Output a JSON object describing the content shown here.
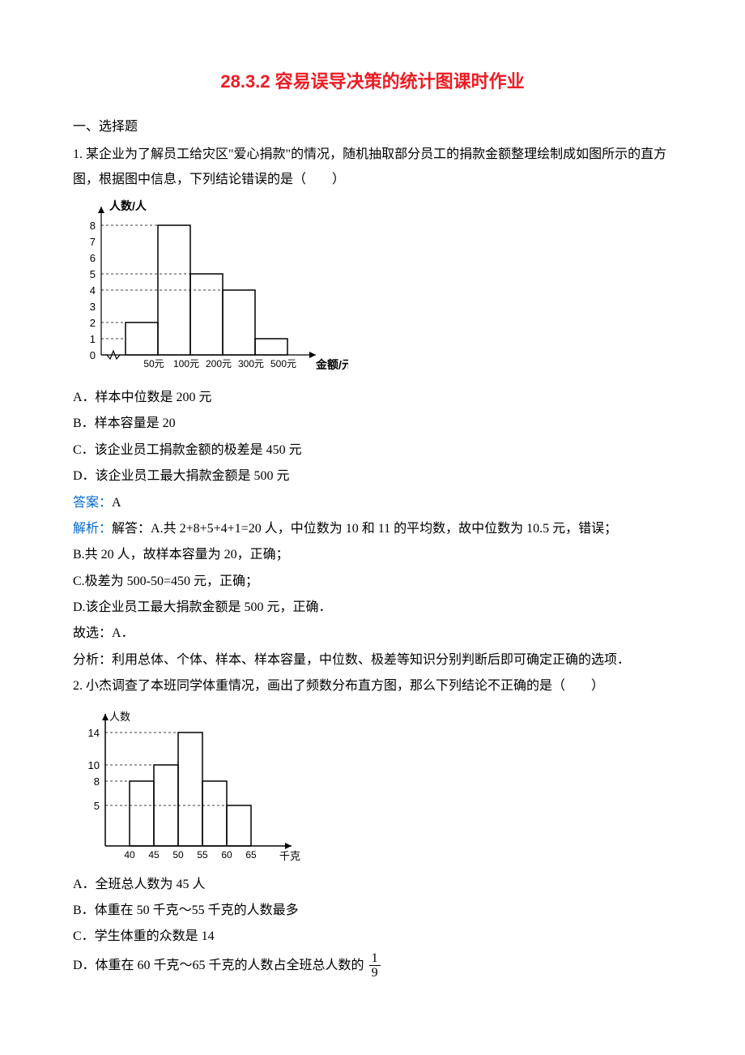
{
  "title": "28.3.2 容易误导决策的统计图课时作业",
  "section1": "一、选择题",
  "q1": {
    "stem": "1. 某企业为了解员工给灾区\"爱心捐款\"的情况，随机抽取部分员工的捐款金额整理绘制成如图所示的直方图，根据图中信息，下列结论错误的是（　　）",
    "optA": "A．样本中位数是 200 元",
    "optB": "B．样本容量是 20",
    "optC": "C．该企业员工捐款金额的极差是 450 元",
    "optD": "D．该企业员工最大捐款金额是 500 元",
    "ans_label": "答案：",
    "ans_val": "A",
    "ana_label": "解析：",
    "ana1": "解答：A.共 2+8+5+4+1=20 人，中位数为 10 和 11 的平均数，故中位数为 10.5 元，错误；",
    "ana2": "B.共 20 人，故样本容量为 20，正确；",
    "ana3": "C.极差为 500-50=450 元，正确；",
    "ana4": "D.该企业员工最大捐款金额是 500 元，正确．",
    "ana5": "故选：A．",
    "ana6": "分析：利用总体、个体、样本、样本容量，中位数、极差等知识分别判断后即可确定正确的选项．"
  },
  "q2": {
    "stem": "2. 小杰调查了本班同学体重情况，画出了频数分布直方图，那么下列结论不正确的是（　　）",
    "optA": "A．全班总人数为 45 人",
    "optB": "B．体重在 50 千克～55 千克的人数最多",
    "optC": "C．学生体重的众数是 14",
    "optD_pre": "D．体重在 60 千克～65 千克的人数占全班总人数的",
    "frac_num": "1",
    "frac_den": "9"
  },
  "chart_data": [
    {
      "type": "bar",
      "title": "",
      "xlabel": "金额/元",
      "ylabel": "人数/人",
      "categories": [
        "50元",
        "100元",
        "200元",
        "300元",
        "500元"
      ],
      "values": [
        2,
        8,
        5,
        4,
        1
      ],
      "yticks": [
        0,
        1,
        2,
        3,
        4,
        5,
        6,
        7,
        8
      ],
      "ylim": [
        0,
        8
      ]
    },
    {
      "type": "bar",
      "title": "",
      "xlabel": "千克",
      "ylabel": "人数",
      "categories": [
        "40",
        "45",
        "50",
        "55",
        "60",
        "65"
      ],
      "bins": [
        [
          40,
          45
        ],
        [
          45,
          50
        ],
        [
          50,
          55
        ],
        [
          55,
          60
        ],
        [
          60,
          65
        ]
      ],
      "values": [
        8,
        10,
        14,
        8,
        5
      ],
      "yticks": [
        5,
        8,
        10,
        14
      ],
      "ylim": [
        0,
        15
      ]
    }
  ],
  "chart1_labels": {
    "y": "人数/人",
    "x": "金额/元",
    "t0": "0",
    "t1": "1",
    "t2": "2",
    "t3": "3",
    "t4": "4",
    "t5": "5",
    "t6": "6",
    "t7": "7",
    "t8": "8",
    "c1": "50元",
    "c2": "100元",
    "c3": "200元",
    "c4": "300元",
    "c5": "500元"
  },
  "chart2_labels": {
    "y": "人数",
    "x": "千克",
    "t5": "5",
    "t8": "8",
    "t10": "10",
    "t14": "14",
    "c1": "40",
    "c2": "45",
    "c3": "50",
    "c4": "55",
    "c5": "60",
    "c6": "65"
  }
}
